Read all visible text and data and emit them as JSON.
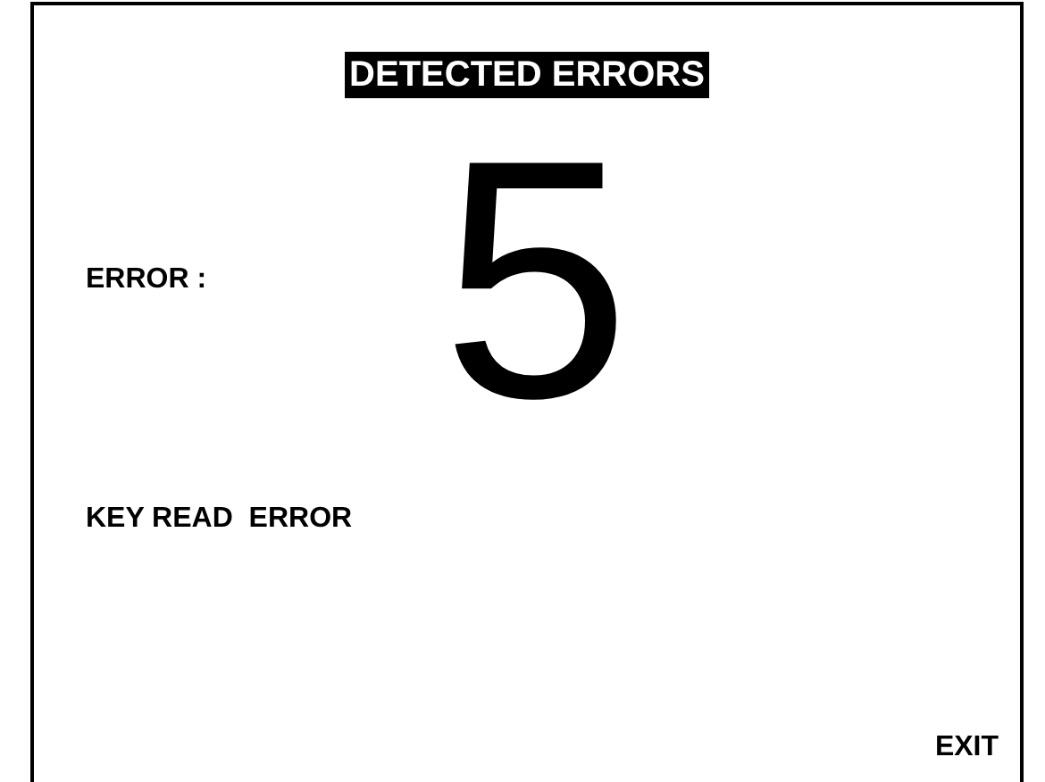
{
  "title": "DETECTED ERRORS",
  "error_label": "ERROR :",
  "error_code": "5",
  "error_message": "KEY READ  ERROR",
  "exit_button": "EXIT"
}
